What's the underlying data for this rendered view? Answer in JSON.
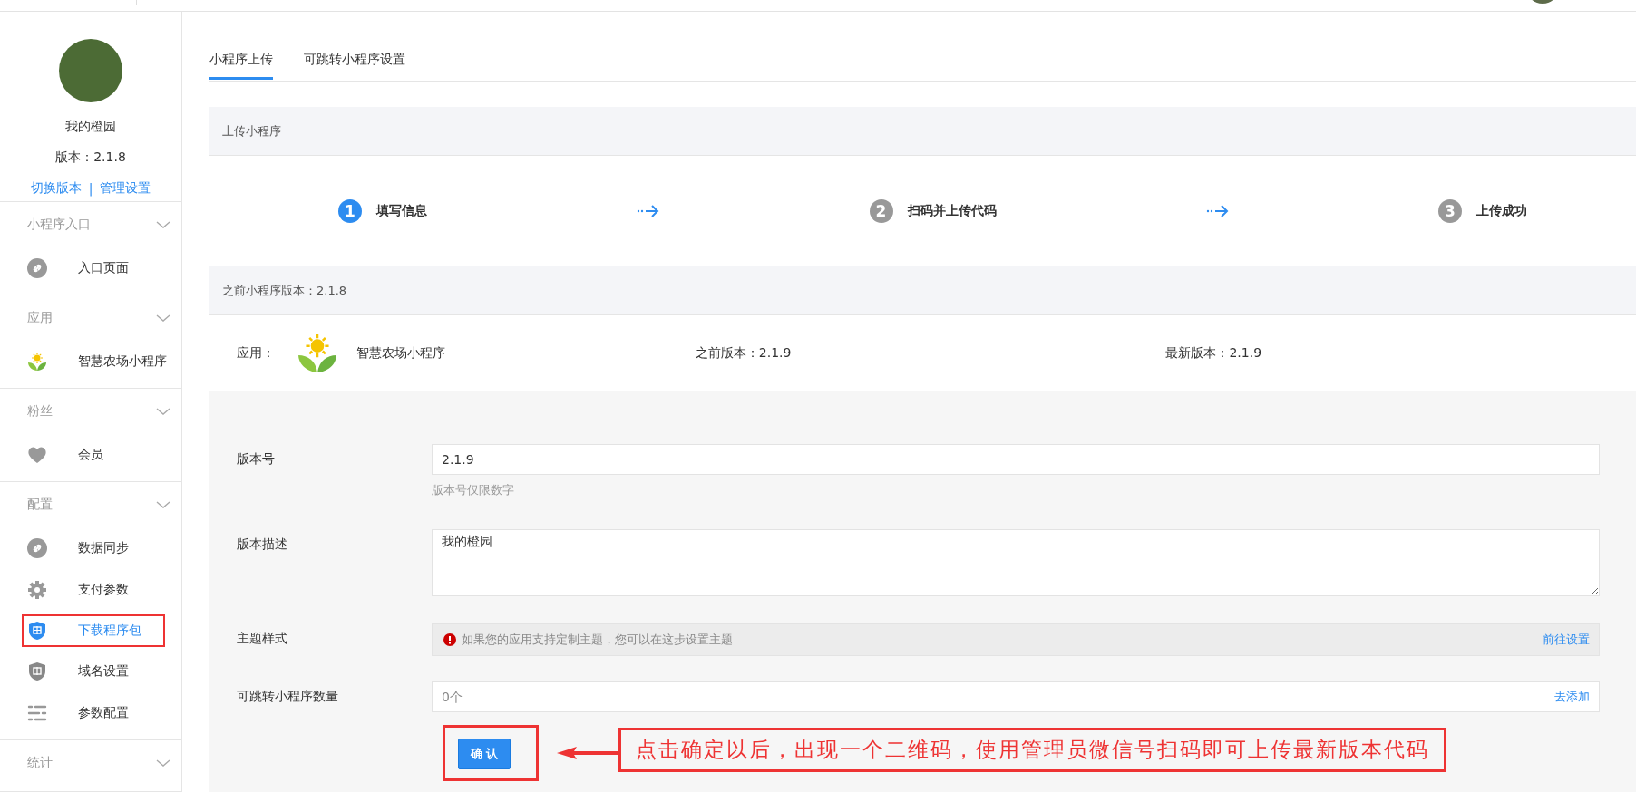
{
  "sidebar": {
    "site_name": "我的橙园",
    "version": "版本：2.1.8",
    "links": [
      "切换版本",
      "管理设置"
    ],
    "separator": "|",
    "sections": [
      {
        "title": "小程序入口",
        "items": [
          {
            "label": "入口页面",
            "kind": "link",
            "selected": false,
            "annotated": false
          }
        ]
      },
      {
        "title": "应用",
        "items": [
          {
            "label": "智慧农场小程序",
            "kind": "logo",
            "selected": false,
            "annotated": false
          }
        ]
      },
      {
        "title": "粉丝",
        "items": [
          {
            "label": "会员",
            "kind": "heart",
            "selected": false,
            "annotated": false
          }
        ]
      },
      {
        "title": "配置",
        "items": [
          {
            "label": "数据同步",
            "kind": "link",
            "selected": false,
            "annotated": false
          },
          {
            "label": "支付参数",
            "kind": "gear",
            "selected": false,
            "annotated": false
          },
          {
            "label": "下载程序包",
            "kind": "shield",
            "selected": true,
            "annotated": true
          },
          {
            "label": "域名设置",
            "kind": "shield",
            "selected": false,
            "annotated": false
          },
          {
            "label": "参数配置",
            "kind": "list",
            "selected": false,
            "annotated": false
          }
        ]
      },
      {
        "title": "统计"
      }
    ]
  },
  "tabs": [
    {
      "label": "小程序上传",
      "selected": true
    },
    {
      "label": "可跳转小程序设置",
      "selected": false
    }
  ],
  "upload_header": "上传小程序",
  "steps": [
    {
      "number": "1",
      "label": "填写信息",
      "active": true
    },
    {
      "number": "2",
      "label": "扫码并上传代码",
      "active": false
    },
    {
      "number": "3",
      "label": "上传成功",
      "active": false
    }
  ],
  "previous_header": "之前小程序版本：2.1.8",
  "app_row": {
    "label": "应用：",
    "app_name": "智慧农场小程序",
    "previous_version": "之前版本：2.1.9",
    "latest_version": "最新版本：2.1.9"
  },
  "form": [
    {
      "kind": "input",
      "label": "版本号",
      "value": "2.1.9",
      "hint": "版本号仅限数字"
    },
    {
      "kind": "textarea",
      "label": "版本描述",
      "value": "我的橙园"
    },
    {
      "kind": "notice",
      "label": "主题样式",
      "text": "如果您的应用支持定制主题，您可以在这步设置主题",
      "link": "前往设置"
    },
    {
      "kind": "linkfield",
      "label": "可跳转小程序数量",
      "placeholder": "0个",
      "link": "去添加"
    }
  ],
  "confirm": {
    "label": "确 认",
    "annotated": true
  },
  "callout": "点击确定以后，出现一个二维码，使用管理员微信号扫码即可上传最新版本代码"
}
